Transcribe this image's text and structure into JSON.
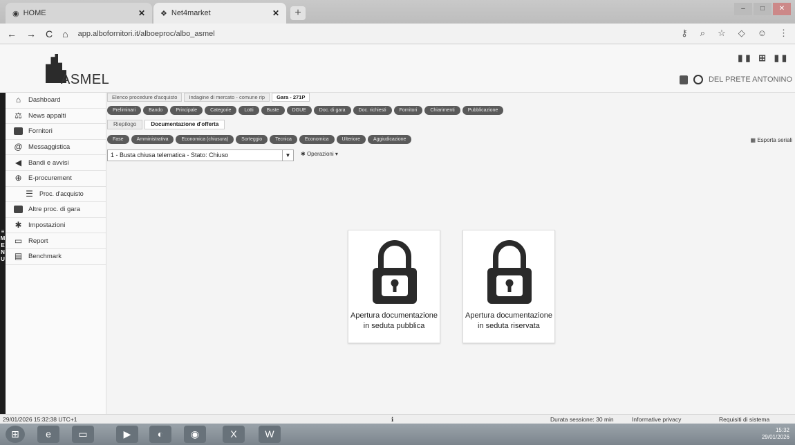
{
  "browser": {
    "tabs": [
      {
        "label": "HOME"
      },
      {
        "label": "Net4market"
      }
    ],
    "url": "app.albofornitori.it/alboeproc/albo_asmel"
  },
  "header": {
    "logo_text": "ASMEL",
    "user_name": "DEL PRETE ANTONINO"
  },
  "sidebar": {
    "menu_word": "MENU",
    "items": [
      {
        "label": "Dashboard"
      },
      {
        "label": "News appalti"
      },
      {
        "label": "Fornitori"
      },
      {
        "label": "Messaggistica"
      },
      {
        "label": "Bandi e avvisi"
      },
      {
        "label": "E-procurement"
      },
      {
        "label": "Proc. d'acquisto"
      },
      {
        "label": "Altre proc. di gara"
      },
      {
        "label": "Impostazioni"
      },
      {
        "label": "Report"
      },
      {
        "label": "Benchmark"
      }
    ]
  },
  "main": {
    "breadcrumbs": [
      {
        "label": "Elenco procedure d'acquisto"
      },
      {
        "label": "Indagine di mercato - comune rip"
      },
      {
        "label": "Gara - 271P"
      }
    ],
    "pills": [
      {
        "label": "Preliminari"
      },
      {
        "label": "Bando"
      },
      {
        "label": "Principale"
      },
      {
        "label": "Categorie"
      },
      {
        "label": "Lotti"
      },
      {
        "label": "Buste"
      },
      {
        "label": "DGUE"
      },
      {
        "label": "Doc. di gara"
      },
      {
        "label": "Doc. richiesti"
      },
      {
        "label": "Fornitori"
      },
      {
        "label": "Chiarimenti"
      },
      {
        "label": "Pubblicazione"
      }
    ],
    "subtabs": [
      {
        "label": "Riepilogo"
      },
      {
        "label": "Documentazione d'offerta"
      }
    ],
    "phases": [
      {
        "label": "Fase"
      },
      {
        "label": "Amministrativa"
      },
      {
        "label": "Economica (chiusura)"
      },
      {
        "label": "Sorteggio"
      },
      {
        "label": "Tecnica"
      },
      {
        "label": "Economica"
      },
      {
        "label": "Ulteriore"
      },
      {
        "label": "Aggiudicazione"
      }
    ],
    "export_label": "Esporta seriali",
    "select_value": "1 - Busta chiusa telematica - Stato: Chiuso",
    "operations_label": "Operazioni",
    "cards": [
      {
        "label": "Apertura documentazione in seduta pubblica"
      },
      {
        "label": "Apertura documentazione in seduta riservata"
      }
    ]
  },
  "status": {
    "timestamp": "29/01/2026 15:32:38 UTC+1",
    "session": "Durata sessione: 30 min",
    "privacy": "Informative privacy",
    "requirements": "Requisiti di sistema"
  },
  "taskbar": {
    "time": "15:32",
    "date": "29/01/2026"
  }
}
